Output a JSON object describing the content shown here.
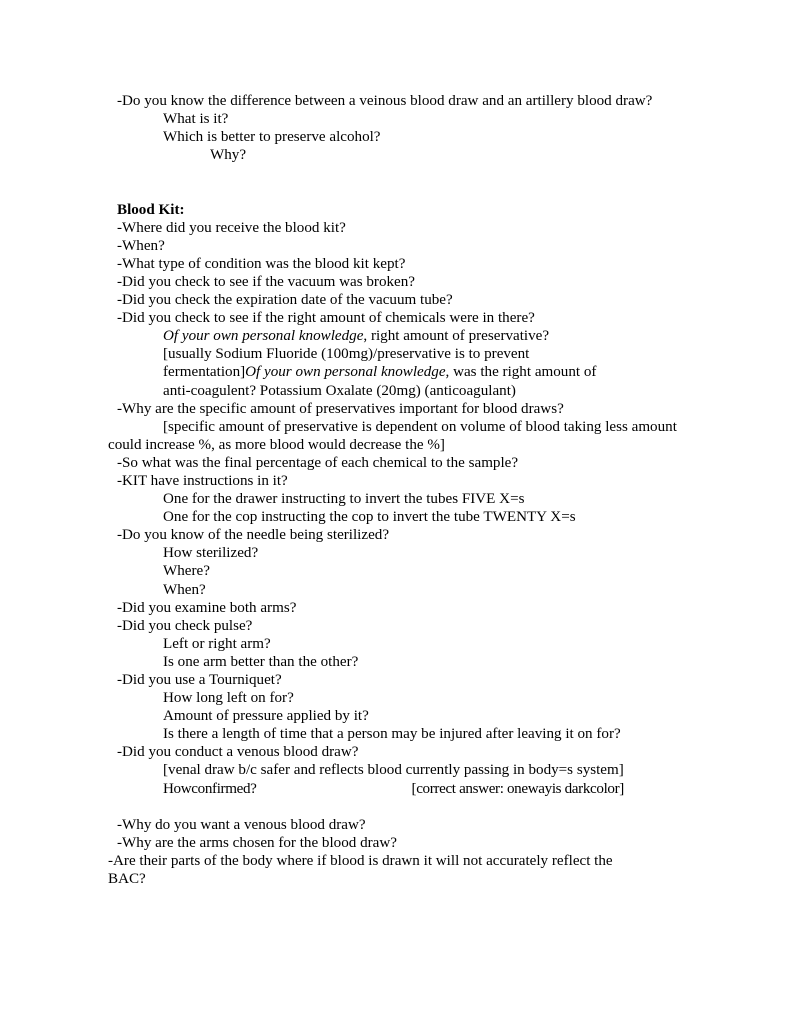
{
  "document": {
    "section_intro": {
      "q_main": "-Do you know the difference between a veinous blood draw and an artillery blood draw?",
      "q_sub1": "What is it?",
      "q_sub2": "Which is better to preserve alcohol?",
      "q_sub3": "Why?"
    },
    "blood_kit": {
      "heading": "Blood Kit:",
      "items": [
        "-Where did you receive the blood kit?",
        "-When?",
        "-What type of condition was the blood kit kept?",
        "-Did you check to see if the vacuum was broken?",
        "-Did you check the expiration date of the vacuum tube?",
        "-Did you check to see if the right amount of chemicals were in there?"
      ],
      "chemicals_note": {
        "italic_1": "Of your own personal knowledge",
        "roman_1": ", right amount of preservative?",
        "line_2": "[usually Sodium Fluoride (100mg)/preservative is to prevent",
        "roman_2a": "fermentation]",
        "italic_2": "Of your own personal knowledge",
        "roman_2b": ", was the right amount of",
        "line_3": "anti-coagulent? Potassium Oxalate (20mg) (anticoagulant)"
      },
      "preservative_q": "-Why are the specific amount of preservatives important for blood draws?",
      "preservative_note": "[specific amount of preservative is dependent on volume of blood taking less amount could increase %, as more blood would decrease the %]",
      "final_percentage_q": "-So what was the final percentage of each chemical to the sample?",
      "kit_instructions_q": "-KIT have instructions in it?",
      "instruction_lines": [
        "One for the drawer instructing to invert the tubes FIVE X=s",
        "One for the cop instructing the cop to invert the tube TWENTY X=s"
      ],
      "needle_q": "-Do you know of the needle being sterilized?",
      "needle_subs": [
        "How sterilized?",
        "Where?",
        "When?"
      ],
      "arms_q": "-Did you examine both arms?",
      "pulse_q": "-Did you check pulse?",
      "pulse_subs": [
        "Left or right arm?",
        "Is one arm better than the other?"
      ],
      "tourniquet_q": "-Did you use a Tourniquet?",
      "tourniquet_subs": [
        "How long left on for?",
        "Amount of pressure applied by it?",
        "Is there a length of time that a person may be injured after leaving it on for?"
      ],
      "venous_q": "-Did you conduct a venous blood draw?",
      "venous_note": "[venal draw b/c safer and reflects blood currently passing in body=s system]",
      "how_confirmed_label": "Howconfirmed?",
      "how_confirmed_answer": "[correct answer: onewayis darkcolor]"
    },
    "closing": {
      "q1": "-Why do you want a venous blood draw?",
      "q2": "-Why are the arms chosen for the blood draw?",
      "q3_line1": "-Are their parts of the body where if blood is drawn it will not accurately reflect the",
      "q3_line2": "BAC?"
    }
  }
}
